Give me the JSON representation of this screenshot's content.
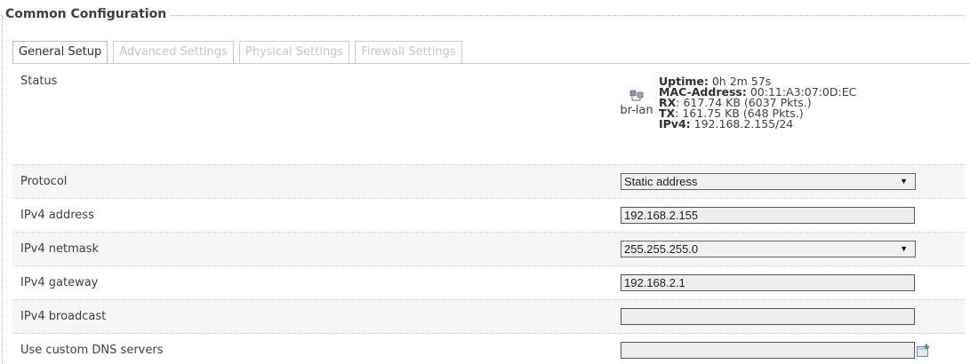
{
  "fieldset": {
    "title": "Common Configuration"
  },
  "tabs": [
    {
      "label": "General Setup",
      "active": true
    },
    {
      "label": "Advanced Settings",
      "active": false
    },
    {
      "label": "Physical Settings",
      "active": false
    },
    {
      "label": "Firewall Settings",
      "active": false
    }
  ],
  "status": {
    "label": "Status",
    "interface": {
      "name": "br-lan",
      "icon": "network-bridge-icon"
    },
    "uptime_label": "Uptime:",
    "uptime": "0h 2m 57s",
    "mac_label": "MAC-Address:",
    "mac": "00:11:A3:07:0D:EC",
    "rx_label": "RX",
    "rx": "617.74 KB (6037 Pkts.)",
    "tx_label": "TX",
    "tx": "161.75 KB (648 Pkts.)",
    "ipv4_label": "IPv4:",
    "ipv4": "192.168.2.155/24"
  },
  "protocol": {
    "label": "Protocol",
    "value": "Static address"
  },
  "ipv4_address": {
    "label": "IPv4 address",
    "value": "192.168.2.155"
  },
  "ipv4_netmask": {
    "label": "IPv4 netmask",
    "value": "255.255.255.0"
  },
  "ipv4_gateway": {
    "label": "IPv4 gateway",
    "value": "192.168.2.1"
  },
  "ipv4_broadcast": {
    "label": "IPv4 broadcast",
    "value": ""
  },
  "dns": {
    "label": "Use custom DNS servers",
    "value": "",
    "add_icon": "add-entry-icon"
  },
  "colors": {
    "row_alt": "#f5f5f5",
    "field_bg": "#eeeeee",
    "tab_inactive": "#c6c6c6"
  }
}
